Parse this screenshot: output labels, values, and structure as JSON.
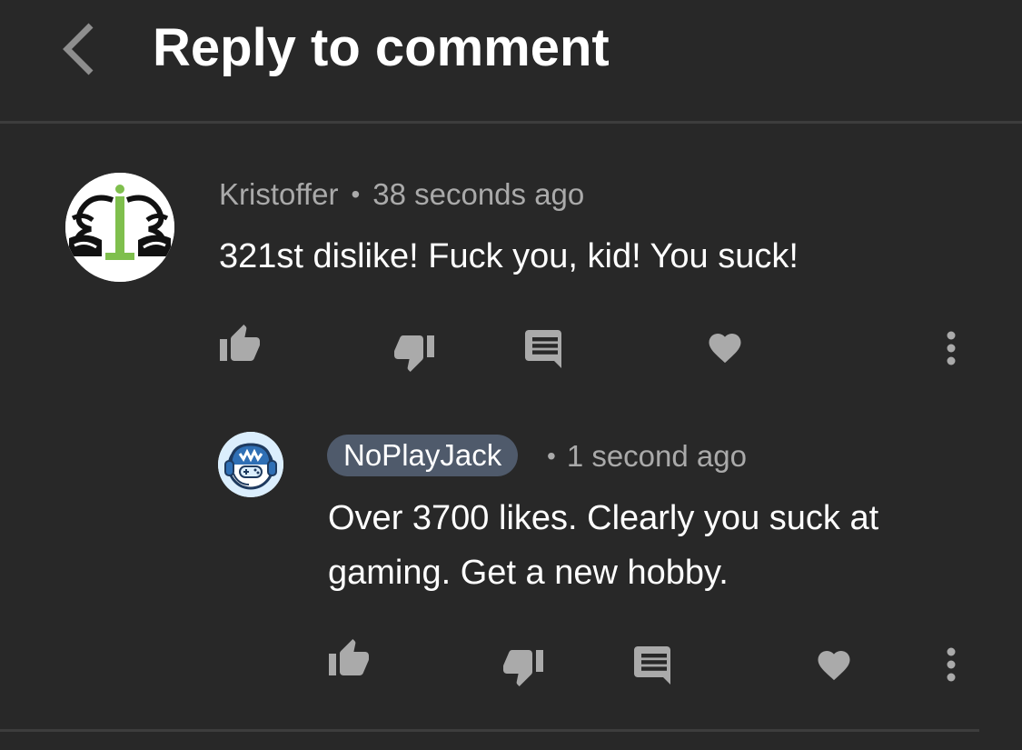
{
  "header": {
    "title": "Reply to comment"
  },
  "comment": {
    "author": "Kristoffer",
    "separator": "•",
    "time": "38 seconds ago",
    "text": "321st dislike! Fuck you, kid! You suck!"
  },
  "reply": {
    "author": "NoPlayJack",
    "separator": "•",
    "time": "1 second ago",
    "text": "Over 3700 likes. Clearly you suck at gaming. Get a new hobby."
  },
  "icons": {
    "back": "chevron-left-icon",
    "like": "thumb-up-icon",
    "dislike": "thumb-down-icon",
    "reply": "comment-icon",
    "heart": "heart-icon",
    "more": "more-vertical-icon"
  },
  "colors": {
    "background": "#282828",
    "text_primary": "#ffffff",
    "text_secondary": "#aaaaaa",
    "icon": "#aaaaaa",
    "author_chip": "#4f5a6b",
    "divider": "#3d3d3d"
  }
}
